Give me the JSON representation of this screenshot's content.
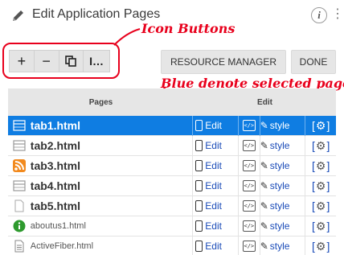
{
  "header": {
    "title": "Edit Application Pages",
    "info_glyph": "i",
    "kebab_glyph": "⋮",
    "icons": {
      "title": "pencil-icon",
      "info": "info-icon",
      "menu": "kebab-menu-icon"
    }
  },
  "toolbar": {
    "add_glyph": "+",
    "remove_glyph": "−",
    "copy_glyph": "⧉",
    "rename_glyph": "I…",
    "resource_manager_label": "RESOURCE MANAGER",
    "done_label": "DONE"
  },
  "annotations": {
    "icon_buttons": "Icon Buttons",
    "selected_note": "Blue denote selected page",
    "color": "#e8001c"
  },
  "table": {
    "col_pages": "Pages",
    "col_edit": "Edit",
    "edit_label": "Edit",
    "style_label": "style",
    "code_glyph": "</>",
    "selected_color": "#0f7de2",
    "rows": [
      {
        "name": "tab1.html",
        "icon": "tab-page-icon",
        "selected": true
      },
      {
        "name": "tab2.html",
        "icon": "tab-page-icon",
        "selected": false
      },
      {
        "name": "tab3.html",
        "icon": "rss-icon",
        "selected": false
      },
      {
        "name": "tab4.html",
        "icon": "tab-page-icon",
        "selected": false
      },
      {
        "name": "tab5.html",
        "icon": "blank-page-icon",
        "selected": false
      },
      {
        "name": "aboutus1.html",
        "icon": "info-green-icon",
        "selected": false
      },
      {
        "name": "ActiveFiber.html",
        "icon": "document-icon",
        "selected": false
      }
    ]
  }
}
